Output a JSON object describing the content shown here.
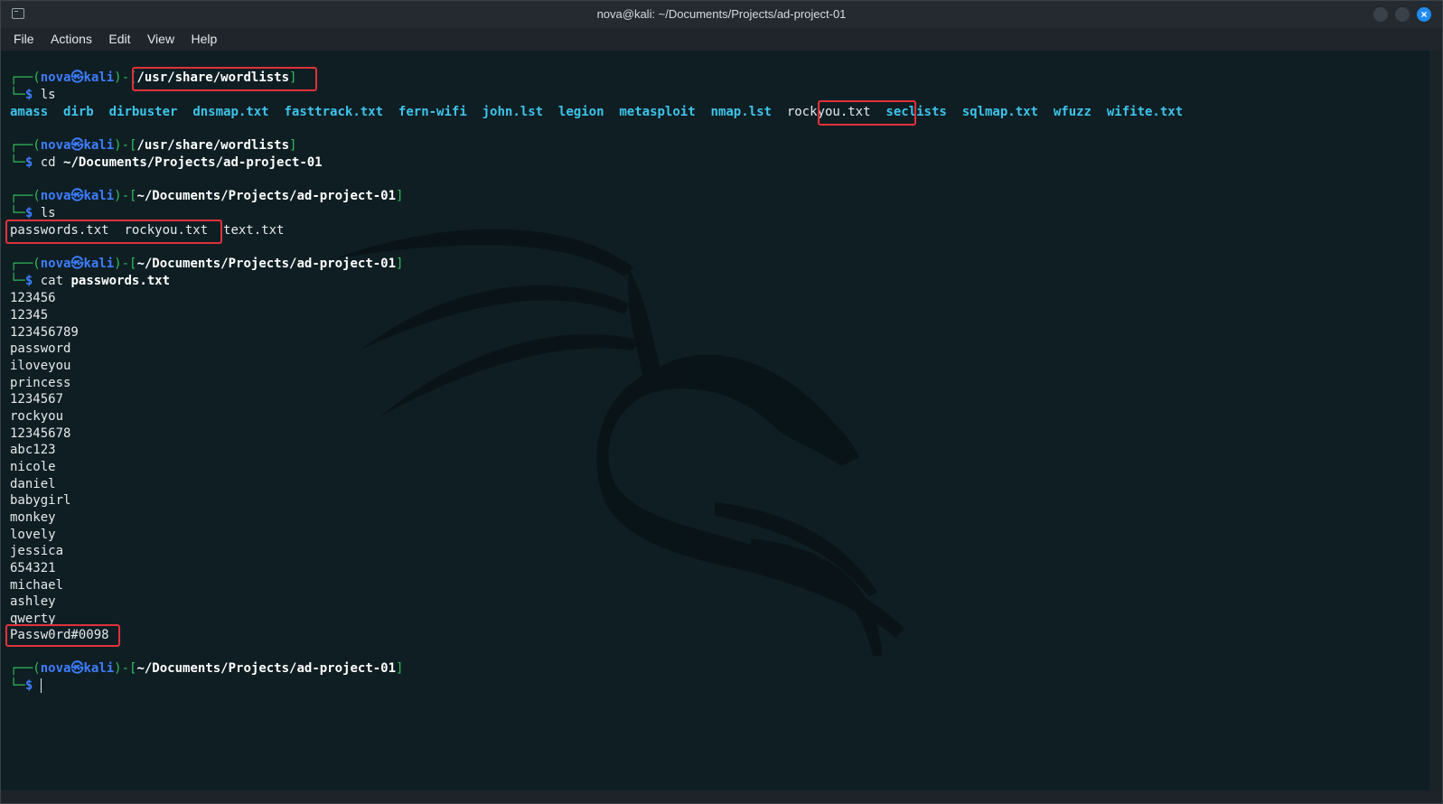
{
  "window": {
    "title": "nova@kali: ~/Documents/Projects/ad-project-01",
    "close_glyph": "×"
  },
  "menu": [
    "File",
    "Actions",
    "Edit",
    "View",
    "Help"
  ],
  "prompt": {
    "user": "nova",
    "at": "㉿",
    "host": "kali",
    "corner_top": "┌──(",
    "corner_bottom": "└─",
    "dollar": "$"
  },
  "blocks": [
    {
      "cwd": "/usr/share/wordlists",
      "cmd": "ls",
      "arg": ""
    },
    {
      "cwd": "/usr/share/wordlists",
      "cmd": "cd",
      "arg": "~/Documents/Projects/ad-project-01"
    },
    {
      "cwd": "~/Documents/Projects/ad-project-01",
      "cmd": "ls",
      "arg": ""
    },
    {
      "cwd": "~/Documents/Projects/ad-project-01",
      "cmd": "cat",
      "arg": "passwords.txt"
    },
    {
      "cwd": "~/Documents/Projects/ad-project-01",
      "cmd": "",
      "arg": ""
    }
  ],
  "wordlists_listing": [
    "amass",
    "dirb",
    "dirbuster",
    "dnsmap.txt",
    "fasttrack.txt",
    "fern-wifi",
    "john.lst",
    "legion",
    "metasploit",
    "nmap.lst",
    "rockyou.txt",
    "seclists",
    "sqlmap.txt",
    "wfuzz",
    "wifite.txt"
  ],
  "project_listing": [
    "passwords.txt",
    "rockyou.txt",
    "text.txt"
  ],
  "passwords": [
    "123456",
    "12345",
    "123456789",
    "password",
    "iloveyou",
    "princess",
    "1234567",
    "rockyou",
    "12345678",
    "abc123",
    "nicole",
    "daniel",
    "babygirl",
    "monkey",
    "lovely",
    "jessica",
    "654321",
    "michael",
    "ashley",
    "qwerty",
    "Passw0rd#0098"
  ],
  "colors": {
    "highlight_box": "#e0323a",
    "prompt_frame": "#2fbf5b",
    "user_host": "#3d7dff",
    "dir_listing": "#3dc4ea"
  }
}
